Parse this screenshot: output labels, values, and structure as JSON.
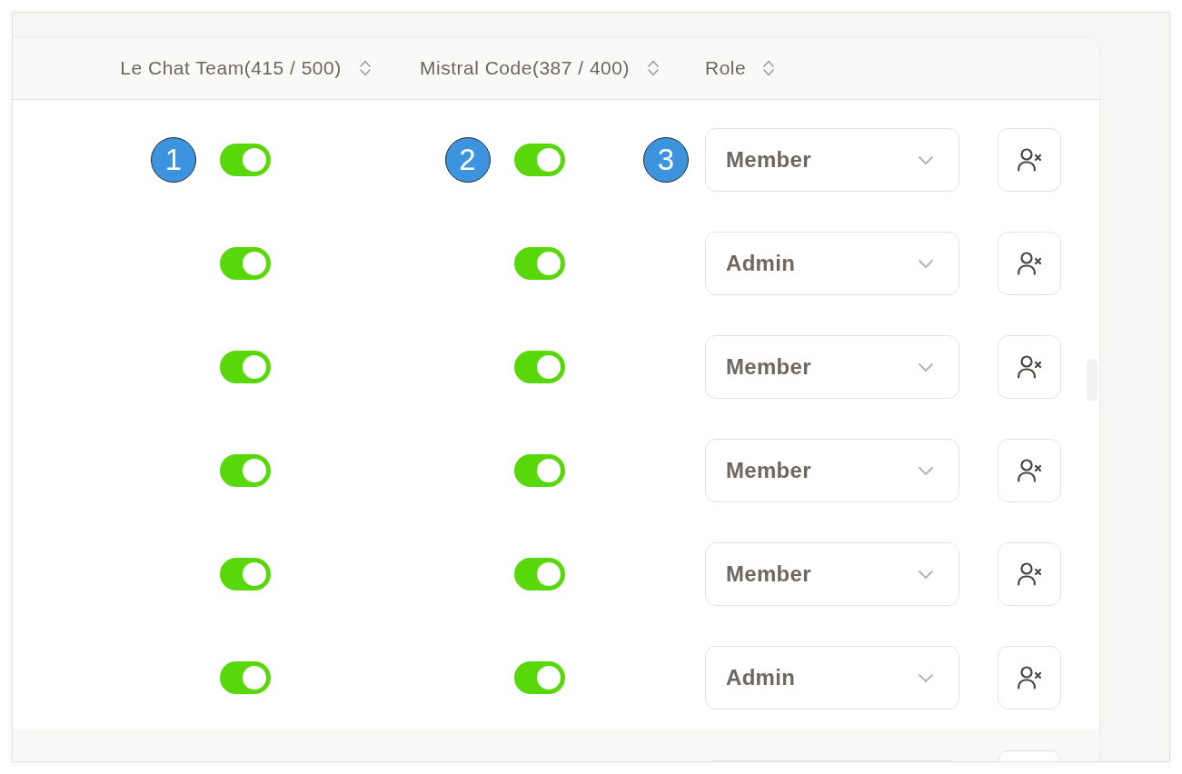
{
  "table": {
    "columns": [
      {
        "label": "Le Chat Team(415 / 500)",
        "sortable": true,
        "marker": "1"
      },
      {
        "label": "Mistral Code(387 / 400)",
        "sortable": true,
        "marker": "2"
      },
      {
        "label": "Role",
        "sortable": true,
        "marker": "3"
      }
    ],
    "rows": [
      {
        "kind": "full",
        "toggles": [
          {
            "on": true
          },
          {
            "on": true
          }
        ],
        "role": "Member"
      },
      {
        "kind": "full",
        "toggles": [
          {
            "on": true
          },
          {
            "on": true
          }
        ],
        "role": "Admin"
      },
      {
        "kind": "full",
        "toggles": [
          {
            "on": true
          },
          {
            "on": true
          }
        ],
        "role": "Member"
      },
      {
        "kind": "full",
        "toggles": [
          {
            "on": true
          },
          {
            "on": true
          }
        ],
        "role": "Member"
      },
      {
        "kind": "full",
        "toggles": [
          {
            "on": true
          },
          {
            "on": true
          }
        ],
        "role": "Member"
      },
      {
        "kind": "full",
        "toggles": [
          {
            "on": true
          },
          {
            "on": true
          }
        ],
        "role": "Admin"
      },
      {
        "kind": "cut"
      }
    ]
  }
}
